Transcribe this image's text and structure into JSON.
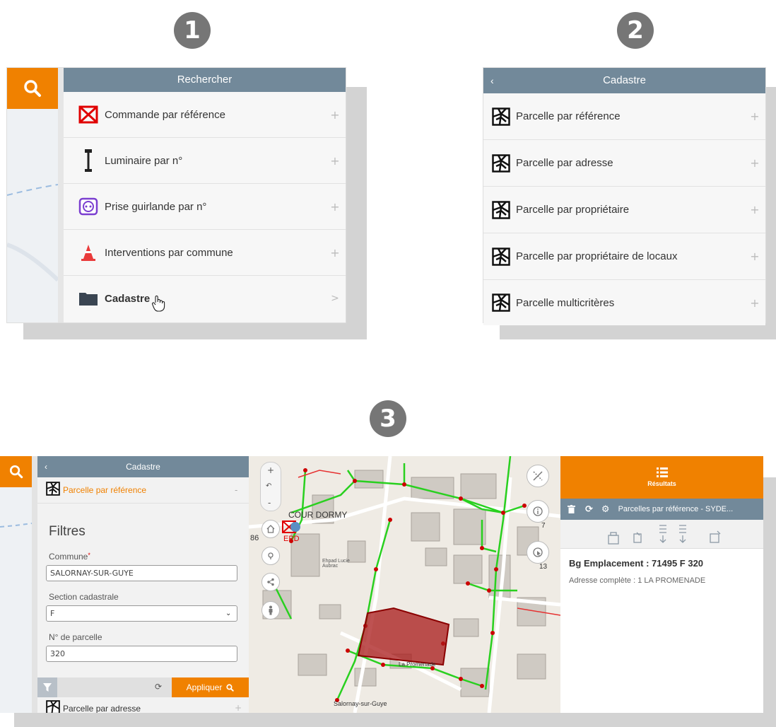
{
  "steps": [
    "1",
    "2",
    "3"
  ],
  "panel1": {
    "title": "Rechercher",
    "items": [
      {
        "label": "Commande par référence",
        "icon": "red-cross-box-icon",
        "action": "+"
      },
      {
        "label": "Luminaire par n°",
        "icon": "street-lamp-icon",
        "action": "+"
      },
      {
        "label": "Prise guirlande par n°",
        "icon": "socket-icon",
        "action": "+"
      },
      {
        "label": "Interventions par commune",
        "icon": "traffic-cone-icon",
        "action": "+"
      },
      {
        "label": "Cadastre",
        "icon": "folder-icon",
        "action": ">"
      }
    ]
  },
  "panel2": {
    "title": "Cadastre",
    "items": [
      {
        "label": "Parcelle par référence",
        "icon": "parcel-icon",
        "action": "+"
      },
      {
        "label": "Parcelle par adresse",
        "icon": "parcel-icon",
        "action": "+"
      },
      {
        "label": "Parcelle par propriétaire",
        "icon": "parcel-icon",
        "action": "+"
      },
      {
        "label": "Parcelle par propriétaire de locaux",
        "icon": "parcel-icon",
        "action": "+"
      },
      {
        "label": "Parcelle multicritères",
        "icon": "parcel-icon",
        "action": "+"
      }
    ]
  },
  "panel3": {
    "header": "Cadastre",
    "active_item": "Parcelle par référence",
    "collapse": "-",
    "filters_title": "Filtres",
    "commune_label": "Commune",
    "required_mark": "*",
    "commune_value": "SALORNAY-SUR-GUYE",
    "section_label": "Section cadastrale",
    "section_value": "F",
    "parcel_label": "N° de parcelle",
    "parcel_value": "320",
    "apply_label": "Appliquer",
    "next_item": "Parcelle par adresse",
    "next_action": "+"
  },
  "map": {
    "labels": {
      "cour_dormy": "COUR DORMY",
      "epd": "EPD",
      "num86": "86",
      "ehpad": "Ehpad Lucie Aubrac",
      "promenade": "La Promenade",
      "salornay": "Salornay-sur-Guye"
    },
    "controls": {
      "zoom_in": "+",
      "zoom_out": "-",
      "badge1": "7",
      "badge2": "13"
    }
  },
  "results": {
    "title": "Résultats",
    "toolbar_text": "Parcelles par référence - SYDE...",
    "result_title": "Bg Emplacement : 71495 F 320",
    "result_sub": "Adresse complète : 1 LA PROMENADE"
  },
  "colors": {
    "orange": "#f08100",
    "header": "#72899a",
    "red": "#e00000",
    "green": "#29d01f"
  }
}
